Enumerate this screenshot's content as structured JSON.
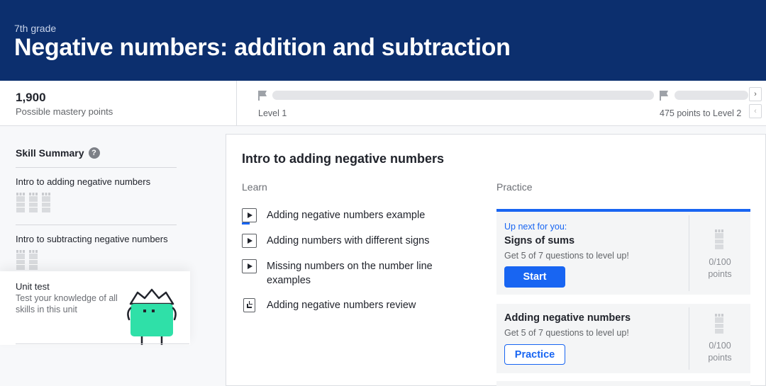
{
  "header": {
    "grade": "7th grade",
    "title": "Negative numbers: addition and subtraction"
  },
  "mastery": {
    "points": "1,900",
    "points_label": "Possible mastery points",
    "level_start": "Level 1",
    "level_next": "475 points to Level 2",
    "progress_fraction": 0
  },
  "sidebar": {
    "title": "Skill Summary",
    "skills": [
      {
        "label": "Intro to adding negative numbers"
      },
      {
        "label": "Intro to subtracting negative numbers"
      }
    ],
    "unit_test": {
      "title": "Unit test",
      "description": "Test your knowledge of all skills in this unit"
    }
  },
  "main": {
    "title": "Intro to adding negative numbers",
    "learn_header": "Learn",
    "practice_header": "Practice",
    "learn_items": [
      {
        "label": "Adding negative numbers example",
        "icon": "video-icon"
      },
      {
        "label": "Adding numbers with different signs",
        "icon": "video-icon"
      },
      {
        "label": "Missing numbers on the number line examples",
        "icon": "video-icon"
      },
      {
        "label": "Adding negative numbers review",
        "icon": "article-icon"
      }
    ],
    "practice_items": [
      {
        "up_next": "Up next for you:",
        "name": "Signs of sums",
        "desc": "Get 5 of 7 questions to level up!",
        "button": "Start",
        "points_value": "0/100",
        "points_unit": "points"
      },
      {
        "name": "Adding negative numbers",
        "desc": "Get 5 of 7 questions to level up!",
        "button": "Practice",
        "points_value": "0/100",
        "points_unit": "points"
      }
    ]
  },
  "colors": {
    "banner": "#0c2f6e",
    "accent": "#1865f2",
    "mascot": "#2fe0a8"
  }
}
